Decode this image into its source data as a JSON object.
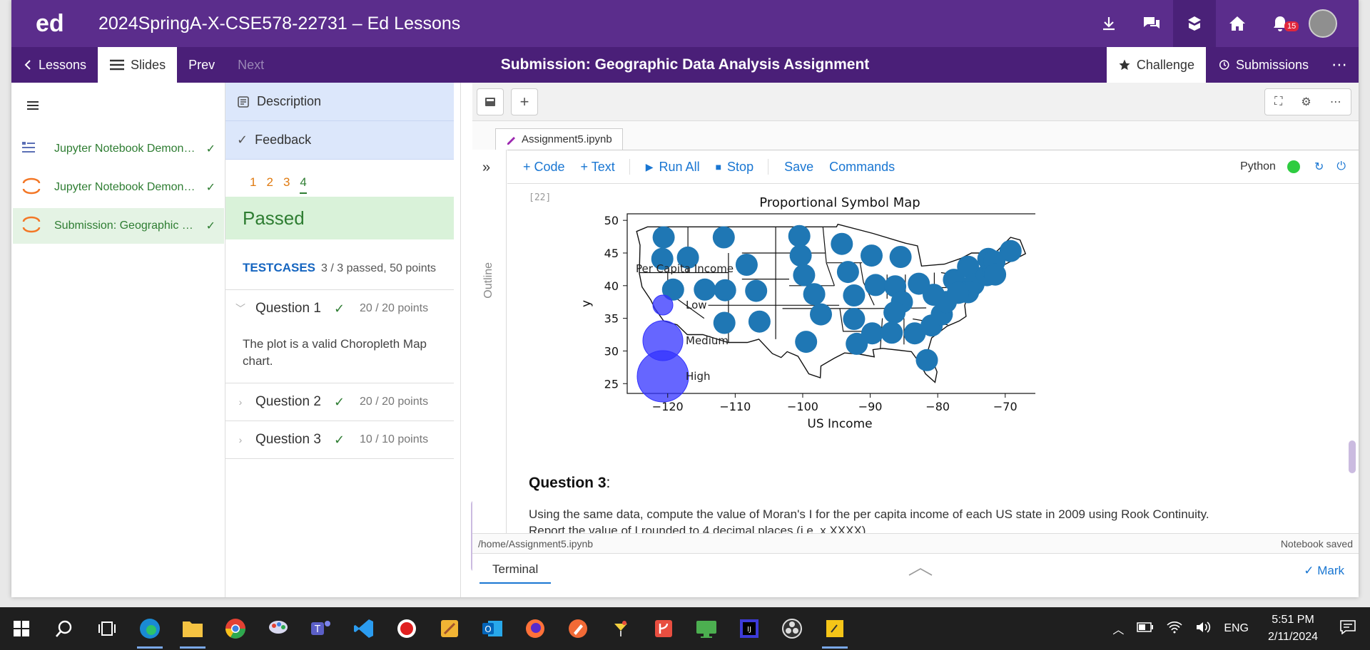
{
  "app": {
    "logo": "ed",
    "title": "2024SpringA-X-CSE578-22731 – Ed Lessons",
    "notification_count": "15"
  },
  "subnav": {
    "lessons": "Lessons",
    "slides": "Slides",
    "prev": "Prev",
    "next": "Next",
    "page_title": "Submission: Geographic Data Analysis Assignment",
    "challenge": "Challenge",
    "submissions": "Submissions"
  },
  "lessons": [
    {
      "label": "Jupyter Notebook Demons..."
    },
    {
      "label": "Jupyter Notebook Demons..."
    },
    {
      "label": "Submission: Geographic D..."
    }
  ],
  "challenge": {
    "description_tab": "Description",
    "feedback_tab": "Feedback",
    "question_numbers": [
      "1",
      "2",
      "3",
      "4"
    ],
    "status": "Passed",
    "testcases_label": "TESTCASES",
    "testcases_summary": "3 / 3 passed, 50 points",
    "questions": [
      {
        "title": "Question 1",
        "points": "20 / 20 points",
        "description": "The plot is a valid Choropleth Map chart."
      },
      {
        "title": "Question 2",
        "points": "20 / 20 points"
      },
      {
        "title": "Question 3",
        "points": "10 / 10 points"
      }
    ]
  },
  "notebook": {
    "file_tab": "Assignment5.ipynb",
    "toolbar": {
      "code": "+ Code",
      "text": "+ Text",
      "run_all": "Run All",
      "stop": "Stop",
      "save": "Save",
      "commands": "Commands",
      "kernel": "Python"
    },
    "outline_label": "Outline",
    "exec_count": "[22]",
    "question3_title": "Question 3",
    "question3_text_line1": "Using the same data, compute the value of Moran's I for the per capita income of each US state in 2009 using Rook Continuity.",
    "question3_text_line2": "Report the value of I rounded to 4 decimal places (i.e. x.XXXX)",
    "path": "/home/Assignment5.ipynb",
    "status": "Notebook saved",
    "terminal": "Terminal",
    "mark": "Mark"
  },
  "chart_data": {
    "type": "scatter",
    "title": "Proportional Symbol Map",
    "xlabel": "US Income",
    "ylabel": "y",
    "xlim": [
      -126,
      -63
    ],
    "ylim": [
      23.5,
      51
    ],
    "xticks": [
      -120,
      -110,
      -100,
      -90,
      -80,
      -70
    ],
    "yticks": [
      25,
      30,
      35,
      40,
      45,
      50
    ],
    "tick_labels_x": [
      "−120",
      "−110",
      "−100",
      "−90",
      "−80",
      "−70"
    ],
    "tick_labels_y": [
      "25",
      "30",
      "35",
      "40",
      "45",
      "50"
    ],
    "points": [
      {
        "x": -120.6,
        "y": 47.4
      },
      {
        "x": -120.8,
        "y": 44.1
      },
      {
        "x": -117,
        "y": 44.3
      },
      {
        "x": -119.2,
        "y": 39.4
      },
      {
        "x": -111.7,
        "y": 47.4
      },
      {
        "x": -108.3,
        "y": 43.2
      },
      {
        "x": -114.5,
        "y": 39.4
      },
      {
        "x": -111.5,
        "y": 39.3
      },
      {
        "x": -106.9,
        "y": 39.2
      },
      {
        "x": -111.6,
        "y": 34.3
      },
      {
        "x": -106.4,
        "y": 34.5
      },
      {
        "x": -100.5,
        "y": 47.6
      },
      {
        "x": -100.3,
        "y": 44.6
      },
      {
        "x": -99.8,
        "y": 41.6
      },
      {
        "x": -98.3,
        "y": 38.7
      },
      {
        "x": -97.3,
        "y": 35.6
      },
      {
        "x": -99.5,
        "y": 31.4
      },
      {
        "x": -94.2,
        "y": 46.4
      },
      {
        "x": -93.3,
        "y": 42.1
      },
      {
        "x": -92.4,
        "y": 38.5
      },
      {
        "x": -92.4,
        "y": 34.9
      },
      {
        "x": -92,
        "y": 31.1
      },
      {
        "x": -89.8,
        "y": 44.6
      },
      {
        "x": -89.2,
        "y": 40.1
      },
      {
        "x": -86.3,
        "y": 39.9
      },
      {
        "x": -85.5,
        "y": 44.4
      },
      {
        "x": -82.8,
        "y": 40.3
      },
      {
        "x": -85.3,
        "y": 37.5
      },
      {
        "x": -86.4,
        "y": 35.9
      },
      {
        "x": -89.7,
        "y": 32.7
      },
      {
        "x": -86.8,
        "y": 32.8
      },
      {
        "x": -83.4,
        "y": 32.7
      },
      {
        "x": -81.6,
        "y": 28.6
      },
      {
        "x": -80.9,
        "y": 33.9
      },
      {
        "x": -79.4,
        "y": 35.6
      },
      {
        "x": -78.8,
        "y": 37.5
      },
      {
        "x": -80.6,
        "y": 38.6
      },
      {
        "x": -77.6,
        "y": 40.9
      },
      {
        "x": -75.5,
        "y": 42.9
      },
      {
        "x": -74.7,
        "y": 40.2
      },
      {
        "x": -75.5,
        "y": 39
      },
      {
        "x": -76.7,
        "y": 39
      },
      {
        "x": -72.7,
        "y": 41.6
      },
      {
        "x": -71.8,
        "y": 42.3
      },
      {
        "x": -72.5,
        "y": 44.1
      },
      {
        "x": -71.6,
        "y": 43.7
      },
      {
        "x": -69.2,
        "y": 45.3
      },
      {
        "x": -71.5,
        "y": 41.7
      },
      {
        "x": -77,
        "y": 38.9
      }
    ],
    "legend": {
      "title": "Per Capita Income",
      "entries": [
        "Low",
        "Medium",
        "High"
      ],
      "placement": "left"
    },
    "colors": {
      "points": "#1f77b4",
      "legend": "#3333ff"
    }
  }
}
